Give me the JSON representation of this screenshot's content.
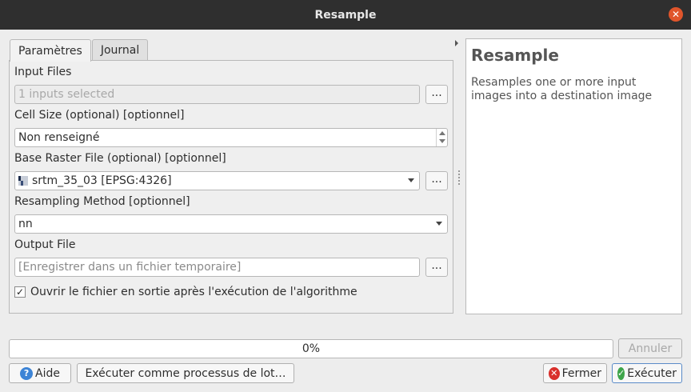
{
  "window": {
    "title": "Resample",
    "close_glyph": "✕"
  },
  "tabs": [
    {
      "label": "Paramètres",
      "active": true
    },
    {
      "label": "Journal",
      "active": false
    }
  ],
  "params": {
    "input_files": {
      "label": "Input Files",
      "value": "1 inputs selected",
      "browse_label": "..."
    },
    "cell_size": {
      "label": "Cell Size (optional) [optionnel]",
      "value": "Non renseigné"
    },
    "base_raster": {
      "label": "Base Raster File (optional) [optionnel]",
      "value": "srtm_35_03 [EPSG:4326]",
      "browse_label": "..."
    },
    "resampling_method": {
      "label": "Resampling Method [optionnel]",
      "value": "nn"
    },
    "output_file": {
      "label": "Output File",
      "placeholder": "[Enregistrer dans un fichier temporaire]",
      "browse_label": "..."
    },
    "open_output": {
      "label": "Ouvrir le fichier en sortie après l'exécution de l'algorithme",
      "checked": true,
      "check_glyph": "✓"
    }
  },
  "help": {
    "title": "Resample",
    "text": "Resamples one or more input images into a destination image"
  },
  "progress": {
    "value": 0,
    "text": "0%",
    "fill_color": "#4a90d9"
  },
  "buttons": {
    "cancel": "Annuler",
    "help": "Aide",
    "batch": "Exécuter comme processus de lot…",
    "close": "Fermer",
    "run": "Exécuter"
  },
  "colors": {
    "titlebar": "#2f2f2f",
    "close_accent": "#e0552b",
    "help_icon": "#3d84d6",
    "close_icon": "#d9302c",
    "run_icon": "#3ea54a"
  }
}
